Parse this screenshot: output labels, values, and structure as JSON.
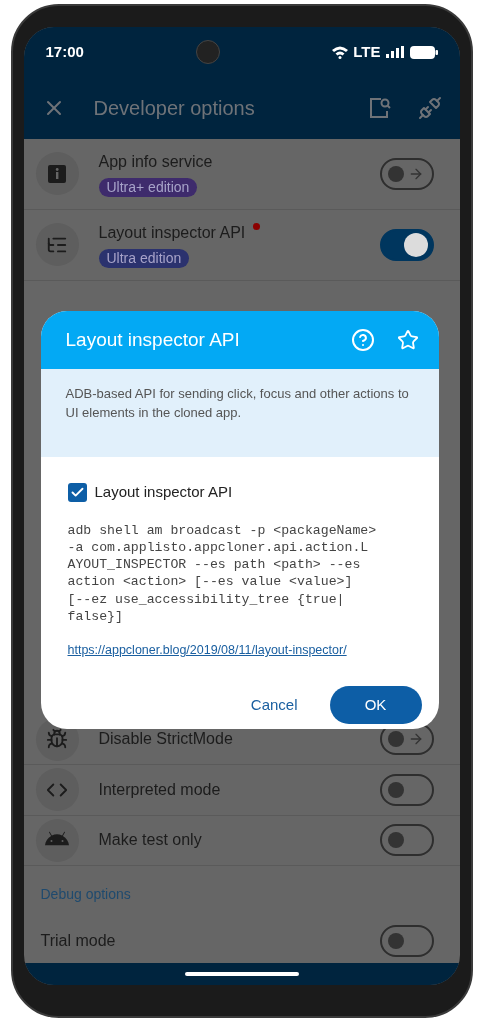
{
  "status_bar": {
    "time": "17:00",
    "network": "LTE"
  },
  "toolbar": {
    "title": "Developer options"
  },
  "rows": [
    {
      "title": "App info service",
      "badge": {
        "label": "Ultra+ edition",
        "color": "#3e2b6c"
      },
      "kind": "action",
      "on": false,
      "unread": false
    },
    {
      "title": "Layout inspector API",
      "badge": {
        "label": "Ultra edition",
        "color": "#2b326e"
      },
      "kind": "toggle",
      "on": true,
      "unread": true
    },
    {
      "title": "Disable StrictMode",
      "kind": "action",
      "on": false,
      "unread": false
    },
    {
      "title": "Interpreted mode",
      "kind": "toggle",
      "on": false,
      "unread": false
    },
    {
      "title": "Make test only",
      "kind": "toggle",
      "on": false,
      "unread": false
    }
  ],
  "section": {
    "title": "Debug options",
    "rows": [
      {
        "title": "Trial mode",
        "kind": "toggle",
        "on": false
      }
    ]
  },
  "dialog": {
    "title": "Layout inspector API",
    "description": "ADB-based API for sending click, focus and other actions to UI elements in the cloned app.",
    "checkbox": {
      "label": "Layout inspector API",
      "checked": true
    },
    "code": "adb shell am broadcast -p <packageName>\n-a com.applisto.appcloner.api.action.L\nAYOUT_INSPECTOR --es path <path> --es\naction <action> [--es value <value>]\n[--ez use_accessibility_tree {true|\nfalse}]",
    "link": "https://appcloner.blog/2019/08/11/layout-inspector/",
    "buttons": [
      {
        "label": "Cancel",
        "kind": "text"
      },
      {
        "label": "OK",
        "kind": "filled"
      }
    ]
  }
}
